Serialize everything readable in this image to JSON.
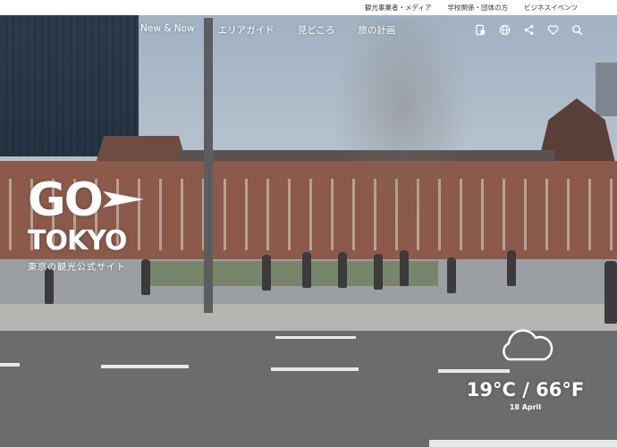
{
  "utility_nav": {
    "items": [
      "観光事業者・メディア",
      "学校関係・団体の方",
      "ビジネスイベンツ"
    ]
  },
  "main_nav": {
    "items": [
      "New & Now",
      "エリアガイド",
      "見どころ",
      "旅の計画"
    ]
  },
  "nav_icons": [
    "translate-page-icon",
    "globe-icon",
    "share-icon",
    "heart-icon",
    "search-icon"
  ],
  "logo": {
    "go": "GO",
    "tokyo": "TOKYO",
    "subtitle": "東京の観光公式サイト"
  },
  "weather": {
    "icon": "cloud-icon",
    "temperature": "19°C / 66°F",
    "date": "18 April"
  },
  "colors": {
    "topbar_bg": "#ffffff",
    "text_light": "#ffffff"
  }
}
